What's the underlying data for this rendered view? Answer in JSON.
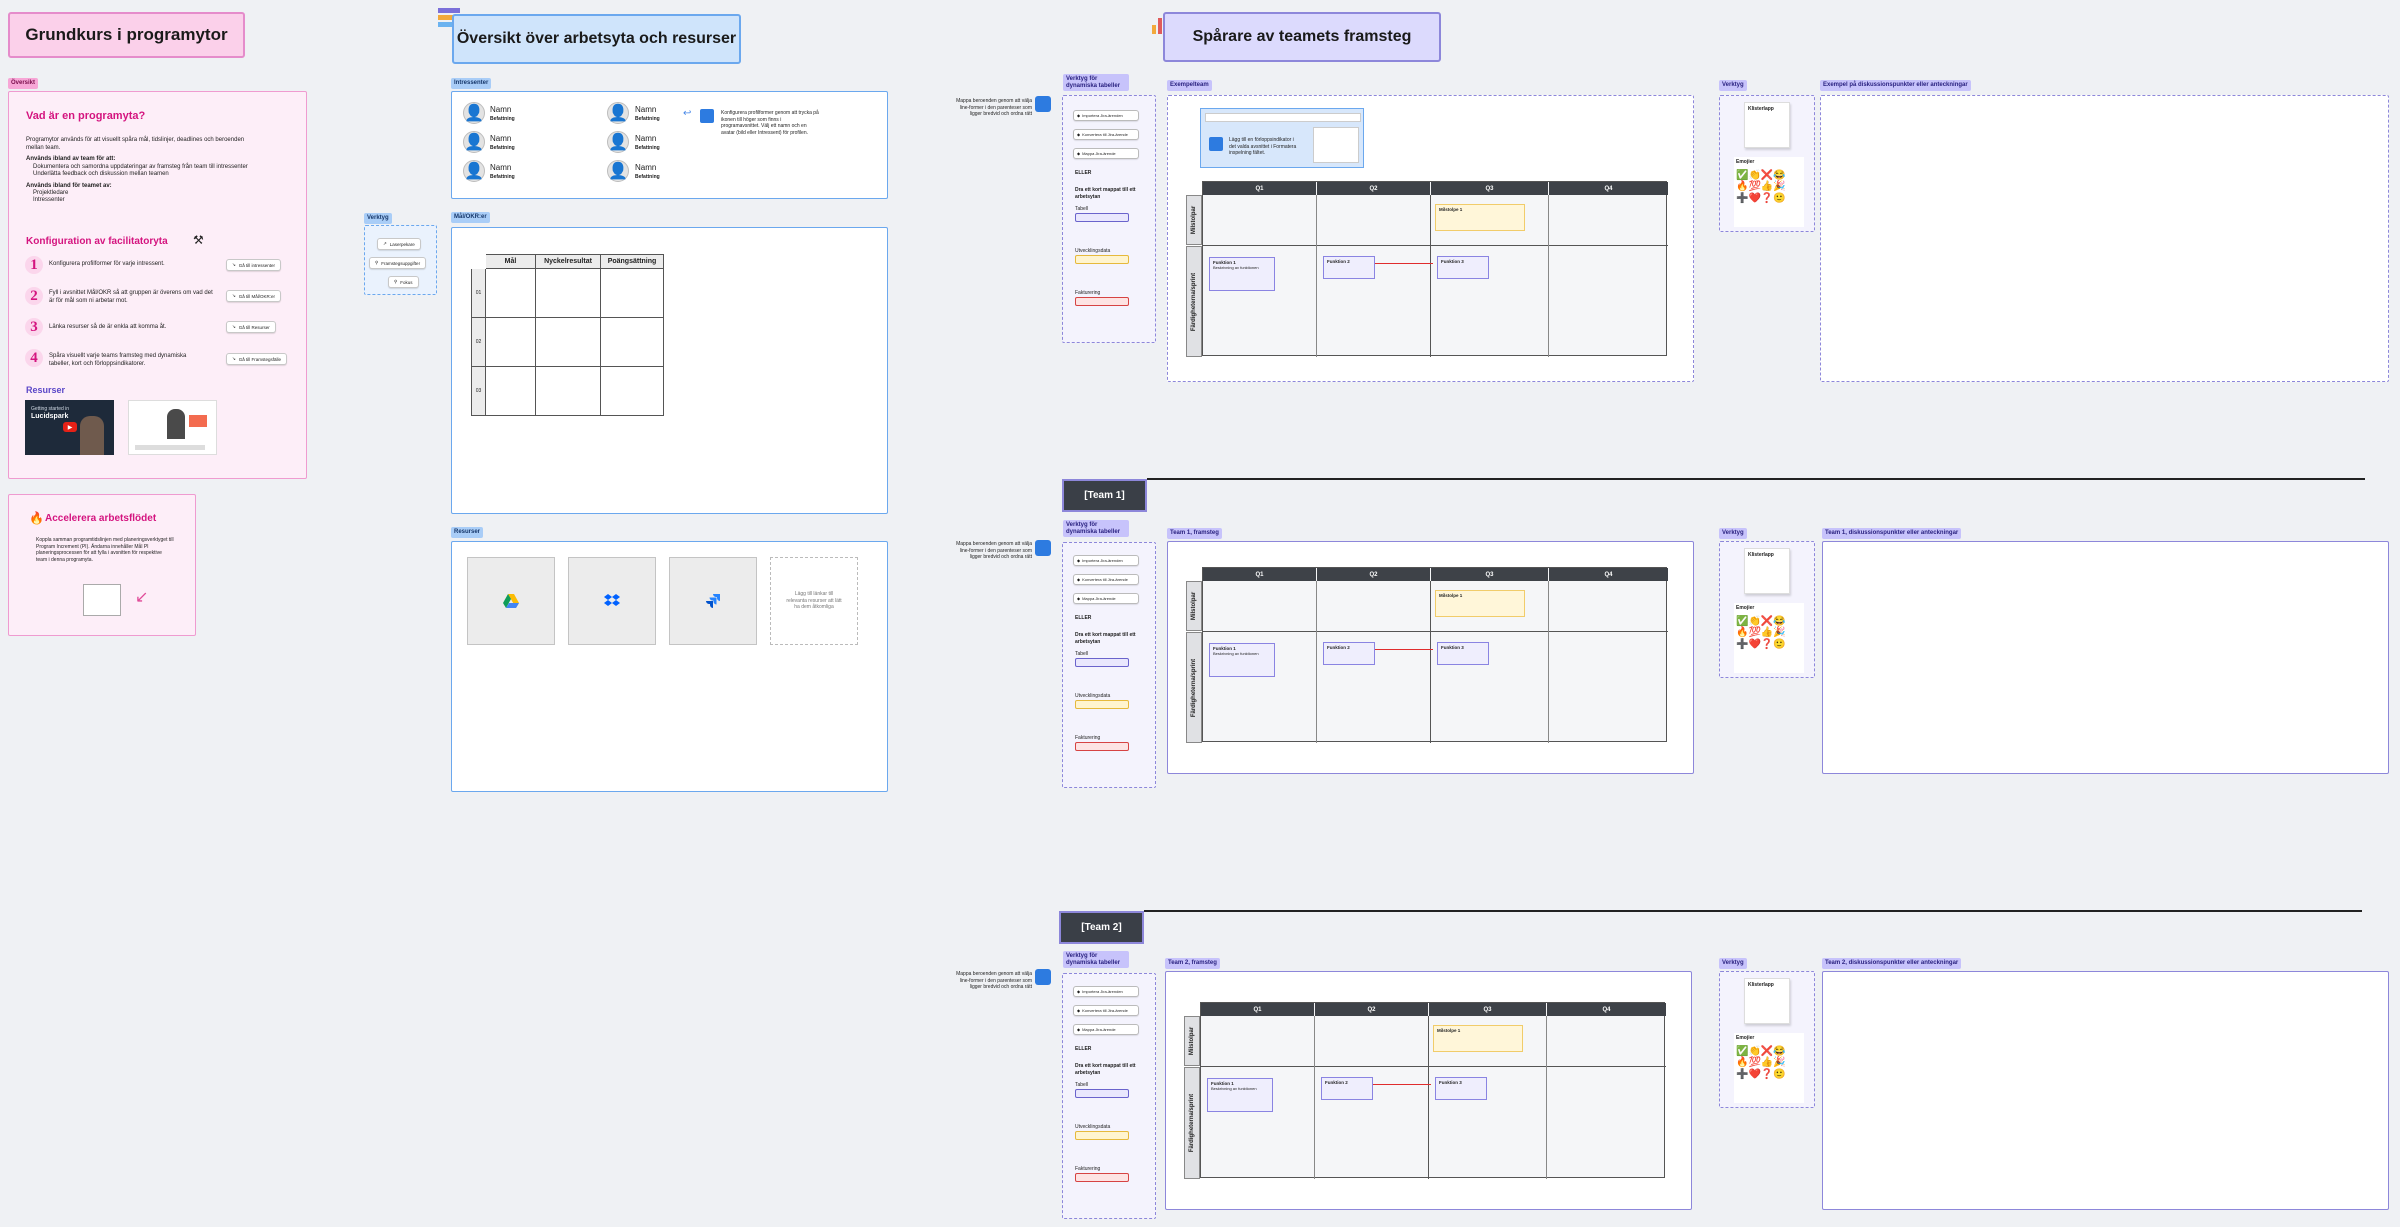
{
  "colors": {
    "pink": "#d4147f",
    "blue": "#4b8ae8",
    "purple": "#8d87da",
    "dark": "#3a3f47"
  },
  "left": {
    "title": "Grundkurs i programytor",
    "overview_tag": "Översikt",
    "what_title": "Vad är en programyta?",
    "what_text": "Programytor används för att visuellt spåra mål, tidslinjer, deadlines och beroenden mellan team.",
    "use_title": "Används ibland av team för att:",
    "use_items": [
      "Dokumentera och samordna uppdateringar av framsteg från team till intressenter",
      "Underlätta feedback och diskussion mellan teamen"
    ],
    "by_title": "Används ibland för teamet av:",
    "by_items": [
      "Projektledare",
      "Intressenter"
    ],
    "config_title": "Konfiguration av facilitatoryta",
    "steps": [
      {
        "num": "1",
        "text": "Konfigurera profilformer för varje intressent.",
        "btn": "Gå till intressenter"
      },
      {
        "num": "2",
        "text": "Fyll i avsnittet Mål/OKR så att gruppen är överens om vad det är för mål som ni arbetar mot.",
        "btn": "Gå till Mål/OKR:er"
      },
      {
        "num": "3",
        "text": "Länka resurser så de är enkla att komma åt.",
        "btn": "Gå till Resurser"
      },
      {
        "num": "4",
        "text": "Spåra visuellt varje teams framsteg med dynamiska tabeller, kort och förloppsindikatorer.",
        "btn": "Gå till Framstegsfälle"
      }
    ],
    "resources_title": "Resurser",
    "video_label": "Lucidspark",
    "video_caption": "Getting started in",
    "accel_title": "Accelerera arbetsflödet",
    "accel_text": "Koppla samman programtidslinjen med planeringsverktyget till Program Increment (PI). Ändarna innehåller Mål PI planeringsprocessen för att fylla i avsnitten för respektive team i denna programyta."
  },
  "middle": {
    "title": "Översikt över arbetsyta och resurser",
    "tools_tag": "Verktyg",
    "tools": [
      "Laserpekare",
      "Framstegsuppgifter",
      "Fokus"
    ],
    "stakeholders_tag": "Intressenter",
    "members": [
      {
        "name": "Namn",
        "role": "Befattning"
      },
      {
        "name": "Namn",
        "role": "Befattning"
      },
      {
        "name": "Namn",
        "role": "Befattning"
      },
      {
        "name": "Namn",
        "role": "Befattning"
      },
      {
        "name": "Namn",
        "role": "Befattning"
      },
      {
        "name": "Namn",
        "role": "Befattning"
      }
    ],
    "stakeholder_note": "Konfigurera profilformer genom att trycka på ikonen till höger som finns i programavsnittet. Välj ett namn och en avatar (bild eller Intressent) för profilen.",
    "okr_tag": "Mål/OKR:er",
    "okr_cols": [
      "Mål",
      "Nyckelresultat",
      "Poängsättning"
    ],
    "okr_rows": [
      "01",
      "02",
      "03"
    ],
    "resources_tag": "Resurser",
    "add_resource": "Lägg till länkar till relevanta resurser att lätt ha dem åtkomliga"
  },
  "tracker": {
    "title": "Spårare av teamets framsteg",
    "side_note": "Mappa beroenden genom att välja line-former i den parenteser som ligger bredvid och ordna rätt",
    "dyn_tag": "Verktyg för dynamiska tabeller",
    "dyn_buttons": [
      "Importera Jira-ärenden",
      "Konvertera till Jira-ärende",
      "Mappa Jira-ärende"
    ],
    "or_label": "ELLER",
    "progress_label": "Dra ett kort mappat till ett arbetsytan",
    "bar_labels": [
      "Tabell",
      "Utvecklingsdata",
      "Fakturering"
    ],
    "example_tag": "Exempelteam",
    "example_note": "Lägg till en förloppsindikator i det valda avsnittet i Formatera inspelning fältet.",
    "tools_tag": "Verktyg",
    "sticky_label": "Klisterlapp",
    "emoji_label": "Emojier",
    "discussion_tag": "Exempel på diskussionspunkter eller anteckningar",
    "quarters": [
      "Q1",
      "Q2",
      "Q3",
      "Q4"
    ],
    "row_milestones": "Milstolpar",
    "row_deliverables": "Färdigheterna/sprint",
    "milestone": "Milstolpe 1",
    "f1": "Funktion 1",
    "f1_desc": "Beskrivning av funktionen",
    "f2": "Funktion 2",
    "f3": "Funktion 3",
    "team1": "[Team 1]",
    "team1_progress": "Team 1, framsteg",
    "team1_discussion": "Team 1, diskussionspunkter eller anteckningar",
    "team2": "[Team 2]",
    "team2_progress": "Team 2, framsteg",
    "team2_discussion": "Team 2, diskussionspunkter eller anteckningar"
  }
}
